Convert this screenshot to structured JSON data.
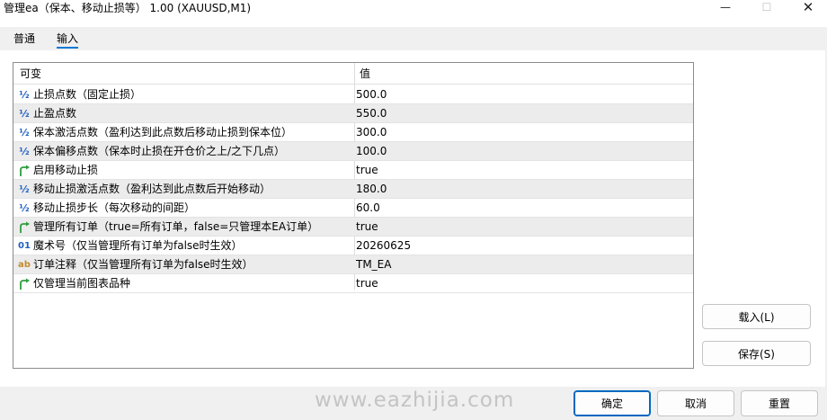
{
  "window": {
    "title": "管理ea（保本、移动止损等） 1.00 (XAUUSD,M1)",
    "minimize_glyph": "—",
    "maximize_glyph": "☐",
    "close_glyph": "✕"
  },
  "tabs": [
    {
      "label": "普通",
      "active": false
    },
    {
      "label": "输入",
      "active": true
    }
  ],
  "accent_color": "#0078d4",
  "grid": {
    "columns": [
      "可变",
      "值"
    ],
    "rows": [
      {
        "icon": "fraction-icon",
        "glyph": "½",
        "name": "止损点数（固定止损）",
        "value": "500.0"
      },
      {
        "icon": "fraction-icon",
        "glyph": "½",
        "name": "止盈点数",
        "value": "550.0"
      },
      {
        "icon": "fraction-icon",
        "glyph": "½",
        "name": "保本激活点数（盈利达到此点数后移动止损到保本位）",
        "value": "300.0"
      },
      {
        "icon": "fraction-icon",
        "glyph": "½",
        "name": "保本偏移点数（保本时止损在开仓价之上/之下几点）",
        "value": "100.0"
      },
      {
        "icon": "boolean-arrow-icon",
        "glyph": "",
        "name": "启用移动止损",
        "value": "true"
      },
      {
        "icon": "fraction-icon",
        "glyph": "½",
        "name": "移动止损激活点数（盈利达到此点数后开始移动）",
        "value": "180.0"
      },
      {
        "icon": "fraction-icon",
        "glyph": "½",
        "name": "移动止损步长（每次移动的间距）",
        "value": "60.0"
      },
      {
        "icon": "boolean-arrow-icon",
        "glyph": "",
        "name": "管理所有订单（true=所有订单，false=只管理本EA订单）",
        "value": "true"
      },
      {
        "icon": "integer-icon",
        "glyph": "01",
        "name": "魔术号（仅当管理所有订单为false时生效）",
        "value": "20260625"
      },
      {
        "icon": "string-icon",
        "glyph": "ab",
        "name": "订单注释（仅当管理所有订单为false时生效）",
        "value": "TM_EA"
      },
      {
        "icon": "boolean-arrow-icon",
        "glyph": "",
        "name": "仅管理当前图表品种",
        "value": "true"
      }
    ]
  },
  "buttons": {
    "load": "载入(L)",
    "save": "保存(S)",
    "ok": "确定",
    "cancel": "取消",
    "reset": "重置"
  },
  "watermark": "www.eazhijia.com"
}
